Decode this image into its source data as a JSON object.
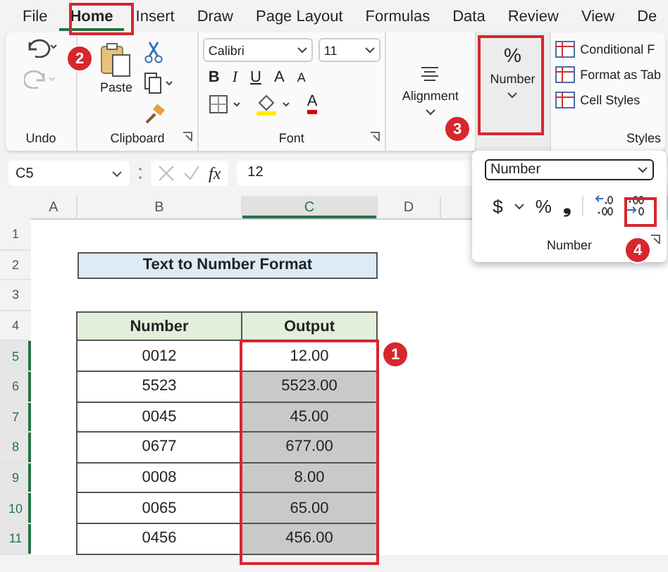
{
  "menu_tabs": [
    {
      "label": "File",
      "selected": false
    },
    {
      "label": "Home",
      "selected": true
    },
    {
      "label": "Insert",
      "selected": false
    },
    {
      "label": "Draw",
      "selected": false
    },
    {
      "label": "Page Layout",
      "selected": false
    },
    {
      "label": "Formulas",
      "selected": false
    },
    {
      "label": "Data",
      "selected": false
    },
    {
      "label": "Review",
      "selected": false
    },
    {
      "label": "View",
      "selected": false
    },
    {
      "label": "De",
      "selected": false
    }
  ],
  "ribbon": {
    "undo": {
      "label": "Undo"
    },
    "clipboard": {
      "paste": "Paste",
      "label": "Clipboard"
    },
    "font": {
      "name": "Calibri",
      "size": "11",
      "bold": "B",
      "italic": "I",
      "underline": "U",
      "grow": "A",
      "shrink": "A",
      "font_color_letter": "A",
      "label": "Font"
    },
    "alignment": {
      "label": "Alignment"
    },
    "number": {
      "symbol": "%",
      "label": "Number"
    },
    "styles": {
      "items": [
        "Conditional F",
        "Format as Tab",
        "Cell Styles"
      ],
      "label": "Styles"
    }
  },
  "formula_bar": {
    "name_box": "C5",
    "fx": "fx",
    "value": "12"
  },
  "columns": [
    {
      "label": "A",
      "selected": false
    },
    {
      "label": "B",
      "selected": false
    },
    {
      "label": "C",
      "selected": true
    },
    {
      "label": "D",
      "selected": false
    }
  ],
  "rows": [
    {
      "label": "1",
      "selected": false
    },
    {
      "label": "2",
      "selected": false
    },
    {
      "label": "3",
      "selected": false
    },
    {
      "label": "4",
      "selected": false
    },
    {
      "label": "5",
      "selected": true
    },
    {
      "label": "6",
      "selected": true
    },
    {
      "label": "7",
      "selected": true
    },
    {
      "label": "8",
      "selected": true
    },
    {
      "label": "9",
      "selected": true
    },
    {
      "label": "10",
      "selected": true
    },
    {
      "label": "11",
      "selected": true
    }
  ],
  "table": {
    "title": "Text to Number Format",
    "columns": [
      "Number",
      "Output"
    ],
    "rows": [
      {
        "number": "0012",
        "output": "12.00",
        "highlighted": false
      },
      {
        "number": "5523",
        "output": "5523.00",
        "highlighted": true
      },
      {
        "number": "0045",
        "output": "45.00",
        "highlighted": true
      },
      {
        "number": "0677",
        "output": "677.00",
        "highlighted": true
      },
      {
        "number": "0008",
        "output": "8.00",
        "highlighted": true
      },
      {
        "number": "0065",
        "output": "65.00",
        "highlighted": true
      },
      {
        "number": "0456",
        "output": "456.00",
        "highlighted": true
      }
    ]
  },
  "number_popup": {
    "format": "Number",
    "currency": "$",
    "percent": "%",
    "comma": "❟",
    "label": "Number"
  },
  "callouts": [
    "1",
    "2",
    "3",
    "4"
  ]
}
